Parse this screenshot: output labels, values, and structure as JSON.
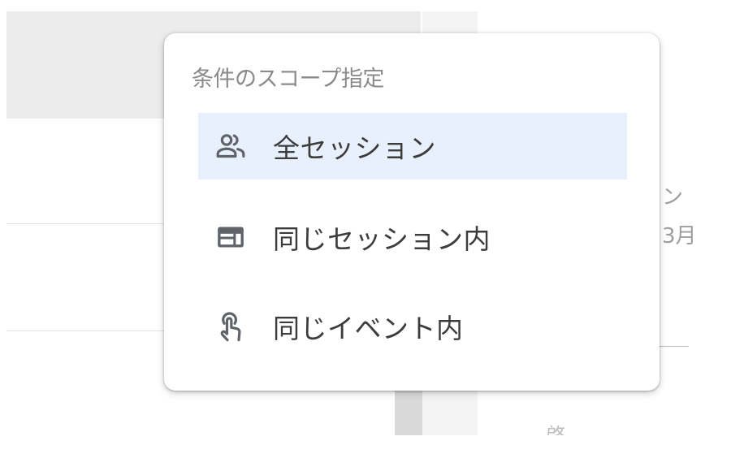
{
  "background": {
    "right_text_1": "ン",
    "right_text_2": "3月",
    "bottom_text": "啓"
  },
  "scope_menu": {
    "heading": "条件のスコープ指定",
    "items": [
      {
        "label": "全セッション",
        "icon": "people-icon",
        "selected": true
      },
      {
        "label": "同じセッション内",
        "icon": "web-layout-icon",
        "selected": false
      },
      {
        "label": "同じイベント内",
        "icon": "touch-hand-icon",
        "selected": false
      }
    ]
  },
  "colors": {
    "selected_background": "#e8f0fe",
    "icon": "#5f6368",
    "heading_text": "#8a8a8a"
  }
}
